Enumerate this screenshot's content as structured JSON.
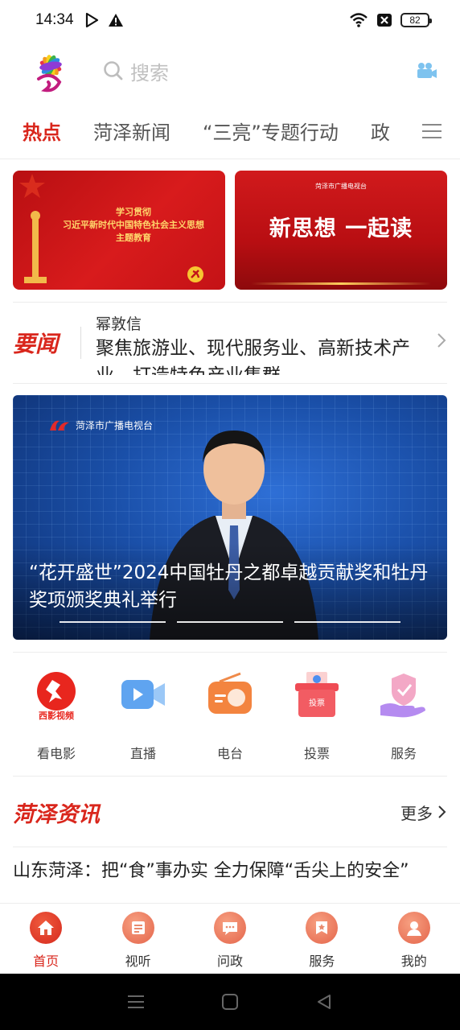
{
  "status": {
    "time": "14:34",
    "battery": "82"
  },
  "search": {
    "placeholder": "搜索"
  },
  "tabs": [
    {
      "label": "热点"
    },
    {
      "label": "菏泽新闻"
    },
    {
      "label": "“三亮”专题行动"
    },
    {
      "label": "政"
    }
  ],
  "banners": {
    "left": {
      "line1": "学习贯彻",
      "line2": "习近平新时代中国特色社会主义思想",
      "line3": "主题教育"
    },
    "right": {
      "title": "新思想 一起读",
      "brand": "菏泽市广播电视台"
    }
  },
  "ticker": {
    "tag": "要闻",
    "author": "幂敦信",
    "title": "聚焦旅游业、现代服务业、高新技术产业…打造特色产业集群"
  },
  "video": {
    "station": "菏泽市广播电视台",
    "title": "“花开盛世”2024中国牡丹之都卓越贡献奖和牡丹奖项颁奖典礼举行"
  },
  "quick": [
    {
      "label": "看电影",
      "icon": "movie-icon",
      "badge": "西影视频"
    },
    {
      "label": "直播",
      "icon": "live-video-icon"
    },
    {
      "label": "电台",
      "icon": "radio-icon"
    },
    {
      "label": "投票",
      "icon": "vote-box-icon",
      "badge": "投票"
    },
    {
      "label": "服务",
      "icon": "service-hand-icon"
    }
  ],
  "section": {
    "title": "菏泽资讯",
    "more": "更多"
  },
  "news": {
    "title": "山东菏泽：把“食”事办实 全力保障“舌尖上的安全”"
  },
  "bottomnav": [
    {
      "label": "首页",
      "icon": "home-icon"
    },
    {
      "label": "视听",
      "icon": "media-icon"
    },
    {
      "label": "问政",
      "icon": "message-icon"
    },
    {
      "label": "服务",
      "icon": "service-icon"
    },
    {
      "label": "我的",
      "icon": "profile-icon"
    }
  ],
  "colors": {
    "accent": "#d9261c",
    "tab_text": "#555555"
  }
}
